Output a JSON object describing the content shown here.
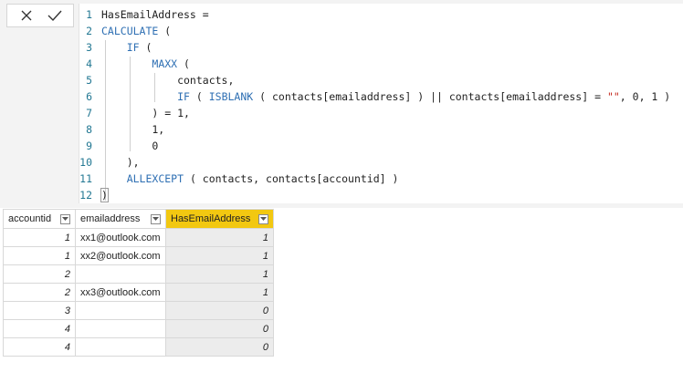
{
  "formula_bar": {
    "lines": [
      {
        "num": "1",
        "segments": [
          {
            "t": "HasEmailAddress =",
            "c": "plain"
          }
        ]
      },
      {
        "num": "2",
        "segments": [
          {
            "t": "CALCULATE",
            "c": "kw"
          },
          {
            "t": " (",
            "c": "plain"
          }
        ]
      },
      {
        "num": "3",
        "segments": [
          {
            "t": "    ",
            "c": "plain"
          },
          {
            "t": "IF",
            "c": "kw"
          },
          {
            "t": " (",
            "c": "plain"
          }
        ]
      },
      {
        "num": "4",
        "segments": [
          {
            "t": "        ",
            "c": "plain"
          },
          {
            "t": "MAXX",
            "c": "kw"
          },
          {
            "t": " (",
            "c": "plain"
          }
        ]
      },
      {
        "num": "5",
        "segments": [
          {
            "t": "            contacts,",
            "c": "plain"
          }
        ]
      },
      {
        "num": "6",
        "segments": [
          {
            "t": "            ",
            "c": "plain"
          },
          {
            "t": "IF",
            "c": "kw"
          },
          {
            "t": " ( ",
            "c": "plain"
          },
          {
            "t": "ISBLANK",
            "c": "kw"
          },
          {
            "t": " ( contacts[emailaddress] ) || contacts[emailaddress] = ",
            "c": "plain"
          },
          {
            "t": "\"\"",
            "c": "str"
          },
          {
            "t": ", 0, 1 )",
            "c": "plain"
          }
        ]
      },
      {
        "num": "7",
        "segments": [
          {
            "t": "        ) = 1,",
            "c": "plain"
          }
        ]
      },
      {
        "num": "8",
        "segments": [
          {
            "t": "        1,",
            "c": "plain"
          }
        ]
      },
      {
        "num": "9",
        "segments": [
          {
            "t": "        0",
            "c": "plain"
          }
        ]
      },
      {
        "num": "10",
        "segments": [
          {
            "t": "    ),",
            "c": "plain"
          }
        ]
      },
      {
        "num": "11",
        "segments": [
          {
            "t": "    ",
            "c": "plain"
          },
          {
            "t": "ALLEXCEPT",
            "c": "kw"
          },
          {
            "t": " ( contacts, contacts[accountid] )",
            "c": "plain"
          }
        ]
      },
      {
        "num": "12",
        "segments": [
          {
            "t": ")",
            "c": "plain"
          }
        ]
      }
    ],
    "cancel_icon": "close-icon",
    "commit_icon": "check-icon"
  },
  "table": {
    "headers": {
      "accountid": "accountid",
      "emailaddress": "emailaddress",
      "hasemail": "HasEmailAddress"
    },
    "rows": [
      {
        "accountid": "1",
        "email": "xx1@outlook.com",
        "has": "1"
      },
      {
        "accountid": "1",
        "email": "xx2@outlook.com",
        "has": "1"
      },
      {
        "accountid": "2",
        "email": "",
        "has": "1"
      },
      {
        "accountid": "2",
        "email": "xx3@outlook.com",
        "has": "1"
      },
      {
        "accountid": "3",
        "email": "",
        "has": "0"
      },
      {
        "accountid": "4",
        "email": "",
        "has": "0"
      },
      {
        "accountid": "4",
        "email": "",
        "has": "0"
      }
    ]
  },
  "colors": {
    "selected_header": "#f2c811",
    "keyword": "#2e6fb3",
    "string": "#c4271c",
    "line_number": "#237893"
  }
}
